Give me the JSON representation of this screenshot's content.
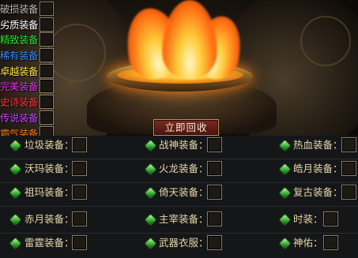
{
  "quality_filters": [
    {
      "label": "破损装备",
      "color": "#b9b9b9"
    },
    {
      "label": "劣质装备",
      "color": "#ffffff"
    },
    {
      "label": "精致装备",
      "color": "#35e03a"
    },
    {
      "label": "稀有装备",
      "color": "#3b8cff"
    },
    {
      "label": "卓越装备",
      "color": "#ffe54a"
    },
    {
      "label": "完美装备",
      "color": "#e03ce8"
    },
    {
      "label": "史诗装备",
      "color": "#ff3b3b"
    },
    {
      "label": "传说装备",
      "color": "#c54aff"
    },
    {
      "label": "霸气装备",
      "color": "#ff7a1a"
    }
  ],
  "recycle_button": {
    "label": "立即回收"
  },
  "equipment_rows": [
    [
      {
        "label": "垃圾装备："
      },
      {
        "label": "战神装备："
      },
      {
        "label": "热血装备："
      }
    ],
    [
      {
        "label": "沃玛装备："
      },
      {
        "label": "火龙装备："
      },
      {
        "label": "皓月装备："
      }
    ],
    [
      {
        "label": "祖玛装备："
      },
      {
        "label": "倚天装备："
      },
      {
        "label": "复古装备："
      }
    ],
    [
      {
        "label": "赤月装备："
      },
      {
        "label": "主宰装备："
      },
      {
        "label": "时装："
      }
    ],
    [
      {
        "label": "雷霆装备："
      },
      {
        "label": "武器衣服："
      },
      {
        "label": "神佑："
      }
    ]
  ],
  "colors": {
    "gem": "#3fcf2f",
    "label_text": "#e6d6a8",
    "button_bg": "#6a221b"
  }
}
